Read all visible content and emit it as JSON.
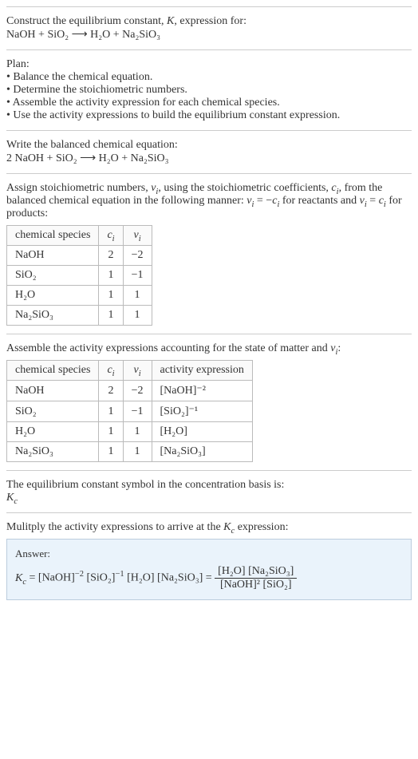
{
  "chart_data": [
    {
      "type": "table",
      "title": "Stoichiometric numbers",
      "categories": [
        "chemical species",
        "c_i",
        "ν_i"
      ],
      "series": [
        {
          "name": "NaOH",
          "values": [
            2,
            -2
          ]
        },
        {
          "name": "SiO2",
          "values": [
            1,
            -1
          ]
        },
        {
          "name": "H2O",
          "values": [
            1,
            1
          ]
        },
        {
          "name": "Na2SiO3",
          "values": [
            1,
            1
          ]
        }
      ]
    },
    {
      "type": "table",
      "title": "Activity expressions",
      "categories": [
        "chemical species",
        "c_i",
        "ν_i",
        "activity expression"
      ],
      "series": [
        {
          "name": "NaOH",
          "values": [
            2,
            -2,
            "[NaOH]^-2"
          ]
        },
        {
          "name": "SiO2",
          "values": [
            1,
            -1,
            "[SiO2]^-1"
          ]
        },
        {
          "name": "H2O",
          "values": [
            1,
            1,
            "[H2O]"
          ]
        },
        {
          "name": "Na2SiO3",
          "values": [
            1,
            1,
            "[Na2SiO3]"
          ]
        }
      ]
    }
  ],
  "intro": {
    "line1": "Construct the equilibrium constant, K, expression for:",
    "eq": "NaOH + SiO₂ ⟶ H₂O + Na₂SiO₃"
  },
  "plan": {
    "heading": "Plan:",
    "b1": "• Balance the chemical equation.",
    "b2": "• Determine the stoichiometric numbers.",
    "b3": "• Assemble the activity expression for each chemical species.",
    "b4": "• Use the activity expressions to build the equilibrium constant expression."
  },
  "balance": {
    "heading": "Write the balanced chemical equation:",
    "eq": "2 NaOH + SiO₂ ⟶ H₂O + Na₂SiO₃"
  },
  "stoich": {
    "text": "Assign stoichiometric numbers, νᵢ, using the stoichiometric coefficients, cᵢ, from the balanced chemical equation in the following manner: νᵢ = −cᵢ for reactants and νᵢ = cᵢ for products:",
    "h1": "chemical species",
    "h2": "cᵢ",
    "h3": "νᵢ",
    "r1c1": "NaOH",
    "r1c2": "2",
    "r1c3": "−2",
    "r2c1": "SiO₂",
    "r2c2": "1",
    "r2c3": "−1",
    "r3c1": "H₂O",
    "r3c2": "1",
    "r3c3": "1",
    "r4c1": "Na₂SiO₃",
    "r4c2": "1",
    "r4c3": "1"
  },
  "activity": {
    "text": "Assemble the activity expressions accounting for the state of matter and νᵢ:",
    "h1": "chemical species",
    "h2": "cᵢ",
    "h3": "νᵢ",
    "h4": "activity expression",
    "r1c1": "NaOH",
    "r1c2": "2",
    "r1c3": "−2",
    "r1c4": "[NaOH]⁻²",
    "r2c1": "SiO₂",
    "r2c2": "1",
    "r2c3": "−1",
    "r2c4": "[SiO₂]⁻¹",
    "r3c1": "H₂O",
    "r3c2": "1",
    "r3c3": "1",
    "r3c4": "[H₂O]",
    "r4c1": "Na₂SiO₃",
    "r4c2": "1",
    "r4c3": "1",
    "r4c4": "[Na₂SiO₃]"
  },
  "symbol": {
    "text": "The equilibrium constant symbol in the concentration basis is:",
    "sym": "K_c"
  },
  "multiply": {
    "text": "Mulitply the activity expressions to arrive at the K_c expression:"
  },
  "answer": {
    "label": "Answer:",
    "lhs": "K_c = [NaOH]⁻² [SiO₂]⁻¹ [H₂O] [Na₂SiO₃] = ",
    "num": "[H₂O] [Na₂SiO₃]",
    "den": "[NaOH]² [SiO₂]"
  }
}
